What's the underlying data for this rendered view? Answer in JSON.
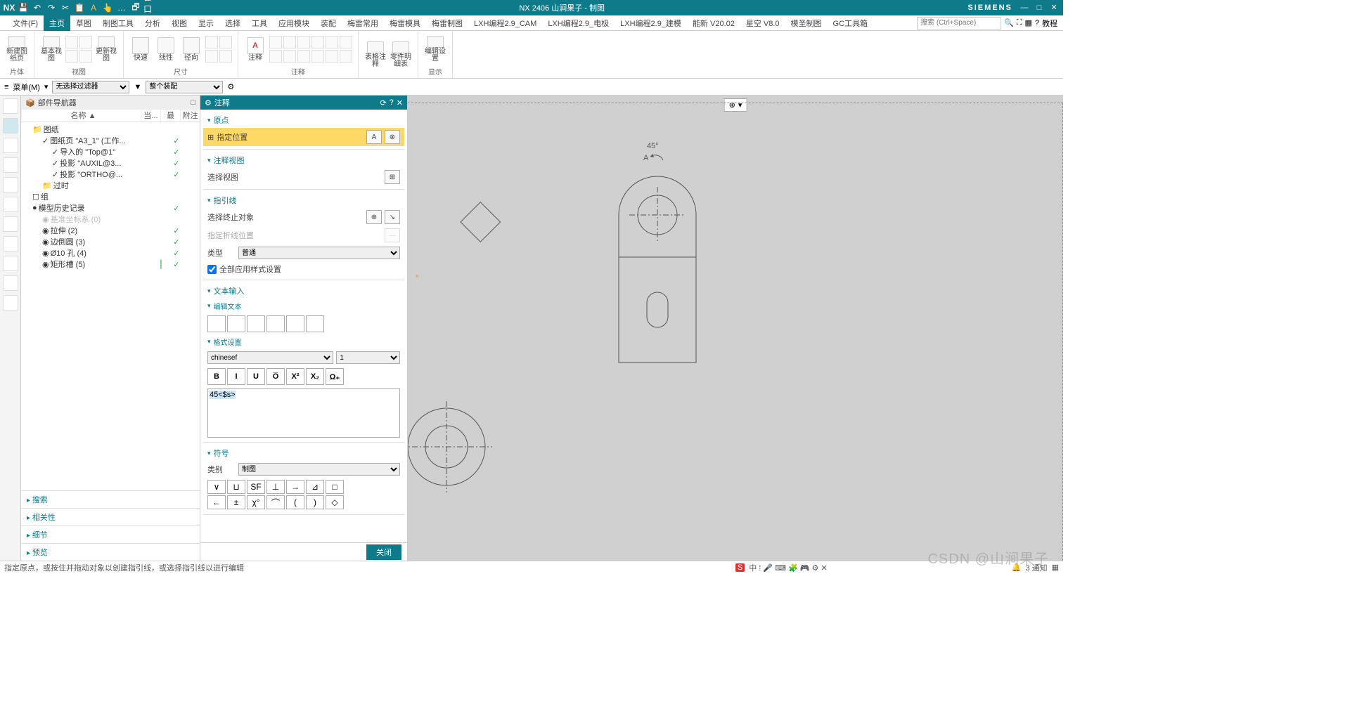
{
  "titlebar": {
    "app": "NX",
    "title": "NX 2406 山涧果子 - 制图",
    "brand": "SIEMENS"
  },
  "menu": {
    "items": [
      "文件(F)",
      "主页",
      "草图",
      "制图工具",
      "分析",
      "视图",
      "显示",
      "选择",
      "工具",
      "应用模块",
      "装配",
      "梅雷常用",
      "梅雷模具",
      "梅雷制图",
      "LXH编程2.9_CAM",
      "LXH编程2.9_电极",
      "LXH编程2.9_建模",
      "能新 V20.02",
      "星空 V8.0",
      "模圣制图",
      "GC工具箱"
    ],
    "active": 1,
    "search_ph": "搜索 (Ctrl+Space)",
    "help": "教程"
  },
  "ribbon": {
    "groups": [
      {
        "label": "片体",
        "items": [
          "新建图纸页"
        ]
      },
      {
        "label": "视图",
        "items": [
          "基本视图",
          "",
          "更新视图"
        ]
      },
      {
        "label": "尺寸",
        "items": [
          "快速",
          "线性",
          "径向"
        ]
      },
      {
        "label": "注释",
        "items": [
          "注释"
        ]
      },
      {
        "label": "",
        "items": [
          "表格注释",
          "零件明细表"
        ]
      },
      {
        "label": "显示",
        "items": [
          "编辑设置"
        ]
      }
    ]
  },
  "filter": {
    "menu": "菜单(M)",
    "sel1": "无选择过滤器",
    "sel2": "整个装配"
  },
  "nav": {
    "title": "部件导航器",
    "cols": [
      "名称 ▲",
      "当...",
      "最",
      "附注"
    ],
    "tree": [
      {
        "pad": 16,
        "ic": "📁",
        "label": "图纸",
        "c1": "",
        "c2": ""
      },
      {
        "pad": 30,
        "ic": "✓",
        "label": "图纸页 \"A3_1\" (工作...",
        "c1": "✓",
        "c2": ""
      },
      {
        "pad": 44,
        "ic": "✓",
        "label": "导入的 \"Top@1\"",
        "c1": "✓",
        "c2": ""
      },
      {
        "pad": 44,
        "ic": "✓",
        "label": "投影 \"AUXIL@3...",
        "c1": "✓",
        "c2": ""
      },
      {
        "pad": 44,
        "ic": "✓",
        "label": "投影 \"ORTHO@...",
        "c1": "✓",
        "c2": ""
      },
      {
        "pad": 30,
        "ic": "📁",
        "label": "过时",
        "c1": "",
        "c2": ""
      },
      {
        "pad": 16,
        "ic": "☐",
        "label": "组",
        "c1": "",
        "c2": ""
      },
      {
        "pad": 16,
        "ic": "●",
        "label": "模型历史记录",
        "c1": "✓",
        "c2": ""
      },
      {
        "pad": 30,
        "ic": "◉",
        "label": "基准坐标系 (0)",
        "c1": "",
        "c2": "",
        "dim": true
      },
      {
        "pad": 30,
        "ic": "◉",
        "label": "拉伸 (2)",
        "c1": "✓",
        "c2": ""
      },
      {
        "pad": 30,
        "ic": "◉",
        "label": "边倒圆 (3)",
        "c1": "✓",
        "c2": ""
      },
      {
        "pad": 30,
        "ic": "◉",
        "label": "Ø10 孔 (4)",
        "c1": "✓",
        "c2": ""
      },
      {
        "pad": 30,
        "ic": "◉",
        "label": "矩形槽 (5)",
        "c1": "✓",
        "c2": "",
        "mark": "⎮"
      }
    ],
    "sections": [
      "搜索",
      "相关性",
      "细节",
      "预览"
    ]
  },
  "dialog": {
    "title": "注释",
    "s1": "原点",
    "row_pos": "指定位置",
    "s2": "注释视图",
    "row_view": "选择视图",
    "s3": "指引线",
    "row_term": "选择终止对象",
    "row_break": "指定折线位置",
    "row_type": "类型",
    "type_val": "普通",
    "row_apply": "全部应用样式设置",
    "s4": "文本输入",
    "s4a": "编辑文本",
    "s4b": "格式设置",
    "font": "chinesef",
    "size": "1",
    "fmt": [
      "B",
      "I",
      "U",
      "O̅",
      "X²",
      "X₂",
      "Ω₊"
    ],
    "input_text": "45<$s>",
    "s5": "符号",
    "row_cat": "类别",
    "cat_val": "制图",
    "symbols": [
      "∨",
      "⊔",
      "SF",
      "⊥",
      "→",
      "⊿",
      "□",
      "←",
      "±",
      "χ°",
      "⌒",
      "(",
      ")",
      "◇"
    ],
    "close": "关闭"
  },
  "canvas": {
    "angle": "45°",
    "marker": "A"
  },
  "status": {
    "hint": "指定原点，或按住并拖动对象以创建指引线，或选择指引线以进行编辑",
    "notif": "3 通知"
  },
  "watermark": "CSDN @山涧果子"
}
